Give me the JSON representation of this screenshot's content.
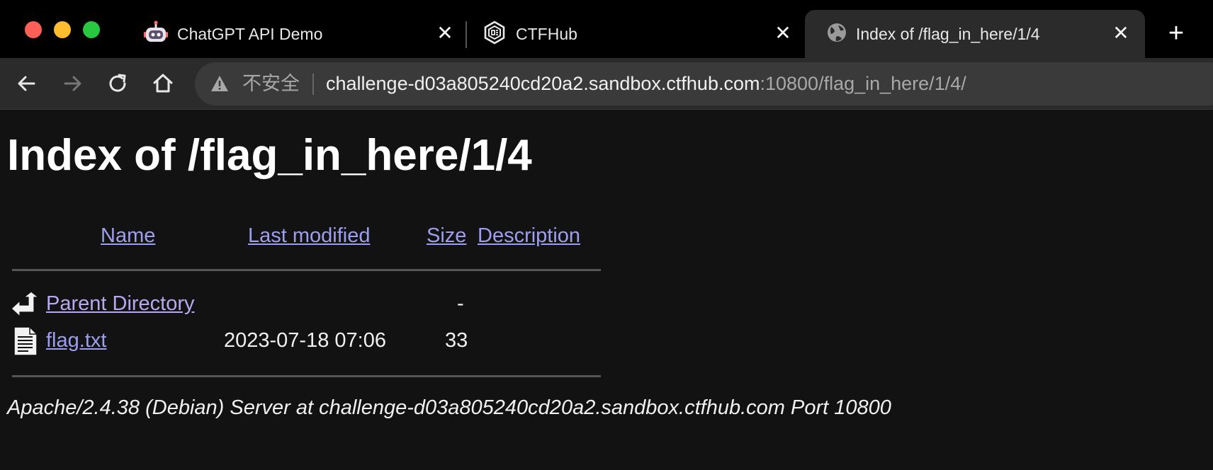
{
  "browser": {
    "tabs": [
      {
        "title": "ChatGPT API Demo",
        "icon": "robot-icon",
        "active": false
      },
      {
        "title": "CTFHub",
        "icon": "ctfhub-logo-icon",
        "active": false
      },
      {
        "title": "Index of /flag_in_here/1/4",
        "icon": "globe-icon",
        "active": true
      }
    ],
    "close_glyph": "✕",
    "new_tab_glyph": "+",
    "security_label": "不安全",
    "url_host": "challenge-d03a805240cd20a2.sandbox.ctfhub.com",
    "url_rest": ":10800/flag_in_here/1/4/"
  },
  "page": {
    "title": "Index of /flag_in_here/1/4",
    "columns": {
      "name": "Name",
      "last_modified": "Last modified",
      "size": "Size",
      "description": "Description"
    },
    "rows": [
      {
        "name": "Parent Directory",
        "last_modified": "",
        "size": "-",
        "description": "",
        "icon": "back-arrow-icon"
      },
      {
        "name": "flag.txt",
        "last_modified": "2023-07-18 07:06",
        "size": "33",
        "description": "",
        "icon": "text-file-icon"
      }
    ],
    "address": "Apache/2.4.38 (Debian) Server at challenge-d03a805240cd20a2.sandbox.ctfhub.com Port 10800"
  },
  "colors": {
    "link": "#9e9ef0",
    "visited_link": "#b8a8f0",
    "background": "#121212"
  }
}
